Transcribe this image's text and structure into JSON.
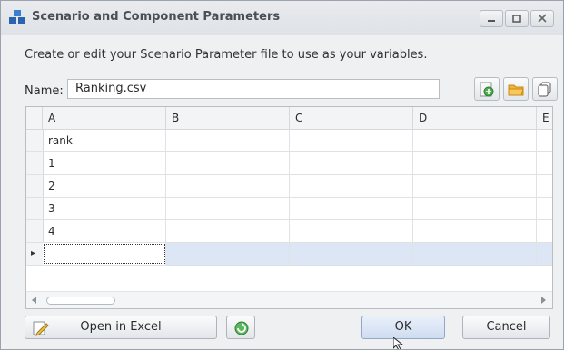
{
  "window": {
    "title": "Scenario and Component Parameters",
    "description": "Create or edit your Scenario Parameter file to use as your variables."
  },
  "file": {
    "name_label": "Name:",
    "name_value": "Ranking.csv"
  },
  "grid": {
    "columns": [
      "A",
      "B",
      "C",
      "D",
      "E"
    ],
    "rows": [
      [
        "rank",
        "",
        "",
        "",
        ""
      ],
      [
        "1",
        "",
        "",
        "",
        ""
      ],
      [
        "2",
        "",
        "",
        "",
        ""
      ],
      [
        "3",
        "",
        "",
        "",
        ""
      ],
      [
        "4",
        "",
        "",
        "",
        ""
      ],
      [
        "",
        "",
        "",
        "",
        ""
      ]
    ],
    "active_row_marker": "▸"
  },
  "buttons": {
    "open_in_excel": "Open in Excel",
    "ok": "OK",
    "cancel": "Cancel"
  },
  "icons": {
    "app": "cubes-icon",
    "new_file": "new-file-icon",
    "open_folder": "folder-icon",
    "copy": "copy-icon",
    "refresh": "refresh-icon",
    "edit": "pencil-icon"
  }
}
